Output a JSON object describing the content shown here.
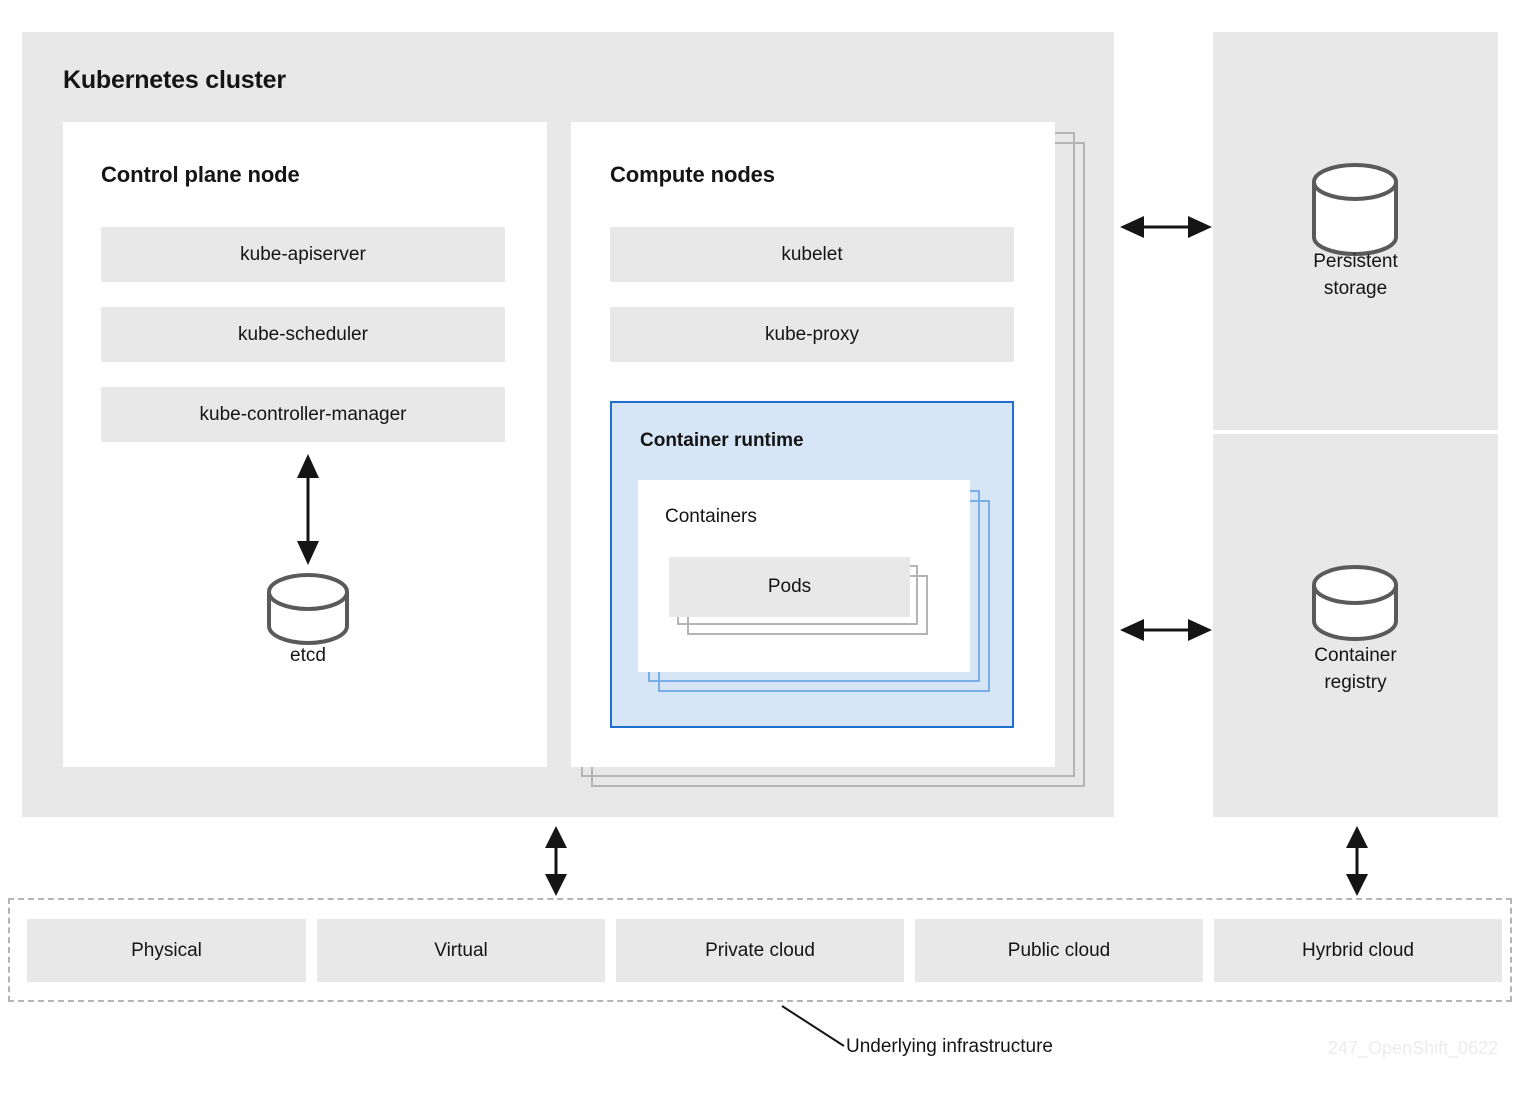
{
  "diagram": {
    "cluster": {
      "title": "Kubernetes cluster",
      "control_plane": {
        "title": "Control plane node",
        "components": [
          {
            "label": "kube-apiserver"
          },
          {
            "label": "kube-scheduler"
          },
          {
            "label": "kube-controller-manager"
          }
        ],
        "datastore": {
          "label": "etcd",
          "icon": "single-disk-cylinder-icon"
        }
      },
      "compute_nodes": {
        "title": "Compute nodes",
        "components": [
          {
            "label": "kubelet"
          },
          {
            "label": "kube-proxy"
          }
        ],
        "container_runtime": {
          "title": "Container runtime",
          "containers": {
            "title": "Containers",
            "pods": {
              "label": "Pods"
            }
          }
        }
      }
    },
    "side_panels": [
      {
        "label_line1": "Persistent",
        "label_line2": "storage",
        "icon": "stacked-disks-icon"
      },
      {
        "label_line1": "Container",
        "label_line2": "registry",
        "icon": "single-disk-cylinder-icon"
      }
    ],
    "infrastructure": {
      "caption": "Underlying infrastructure",
      "items": [
        {
          "label": "Physical"
        },
        {
          "label": "Virtual"
        },
        {
          "label": "Private cloud"
        },
        {
          "label": "Public cloud"
        },
        {
          "label": "Hyrbrid cloud"
        }
      ]
    },
    "watermark": "247_OpenShift_0622",
    "colors": {
      "panel_grey": "#e8e8e8",
      "panel_white": "#ffffff",
      "runtime_blue_fill": "#d6e6f7",
      "runtime_blue_border": "#1f6fd0",
      "stack_outline_grey": "#b4b4b4",
      "stack_outline_blue": "#7aaee8",
      "text": "#151515",
      "watermark": "#ececec"
    }
  }
}
